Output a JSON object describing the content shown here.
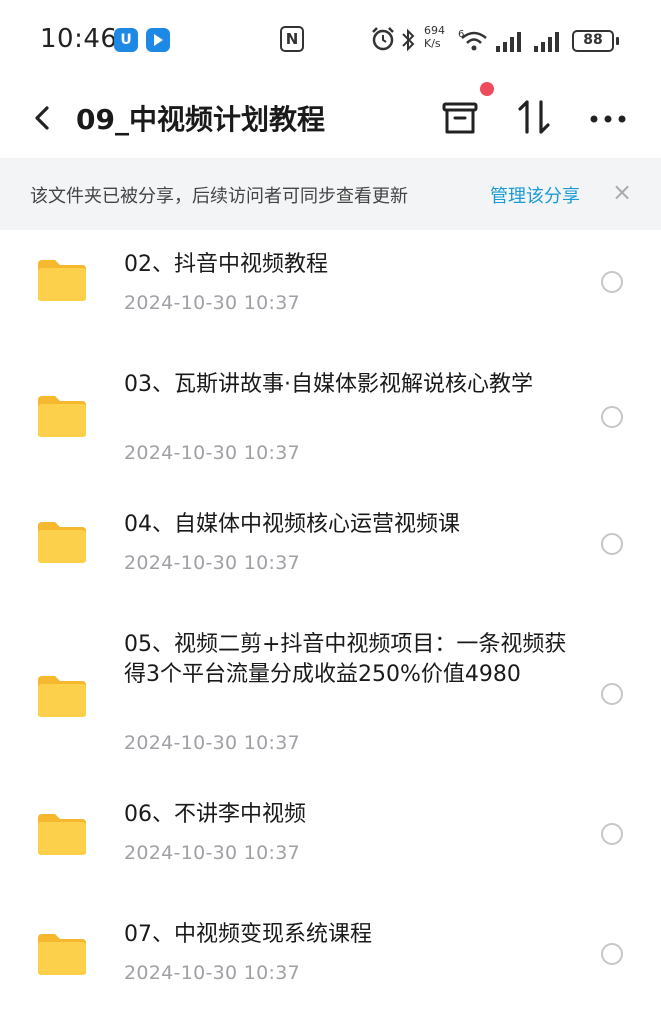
{
  "status_bar": {
    "time": "10:46",
    "badge_1": "U",
    "badge_2": "",
    "nfc": "N",
    "net_speed_value": "694",
    "net_speed_unit": "K/s",
    "wifi_label": "6",
    "battery": "88",
    "icons": [
      "alarm-icon",
      "bluetooth-icon",
      "wifi-icon",
      "signal-icon",
      "signal-icon",
      "battery-icon"
    ]
  },
  "header": {
    "title": "09_中视频计划教程",
    "icons": [
      "back-icon",
      "trash-icon",
      "sort-icon",
      "more-icon"
    ],
    "notification_dot_color": "#f04b5b"
  },
  "share_banner": {
    "text": "该文件夹已被分享，后续访问者可同步查看更新",
    "link": "管理该分享",
    "close": "×",
    "link_color": "#1a9bd8"
  },
  "files": [
    {
      "name": "02、抖音中视频教程",
      "date": "2024-10-30  10:37"
    },
    {
      "name": "03、瓦斯讲故事·自媒体影视解说核心教学",
      "date": "2024-10-30  10:37"
    },
    {
      "name": "04、自媒体中视频核心运营视频课",
      "date": "2024-10-30  10:37"
    },
    {
      "name": "05、视频二剪+抖音中视频项目：一条视频获得3个平台流量分成收益250%价值4980",
      "date": "2024-10-30  10:37"
    },
    {
      "name": "06、不讲李中视频",
      "date": "2024-10-30  10:37"
    },
    {
      "name": "07、中视频变现系统课程",
      "date": "2024-10-30  10:37"
    }
  ],
  "folder_color": "#fcd04a"
}
